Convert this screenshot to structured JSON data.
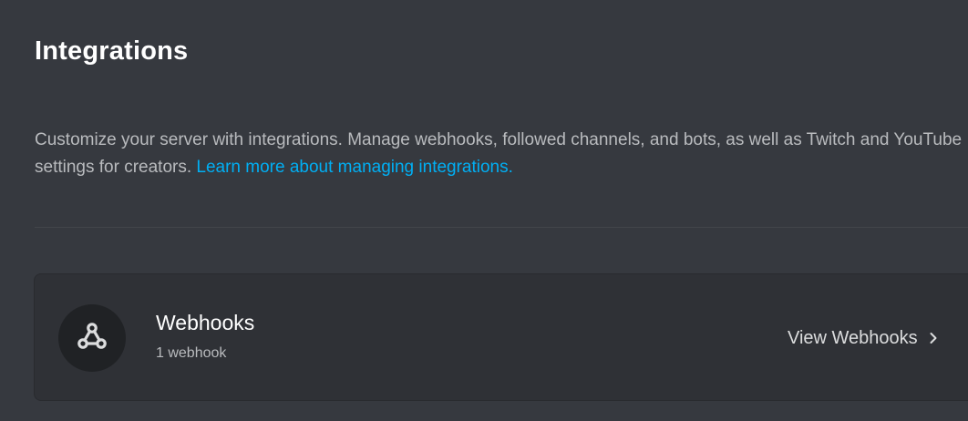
{
  "page": {
    "title": "Integrations",
    "description": "Customize your server with integrations. Manage webhooks, followed channels, and bots, as well as Twitch and YouTube settings for creators.",
    "learn_more_link": "Learn more about managing integrations."
  },
  "webhooks_card": {
    "title": "Webhooks",
    "subtitle": "1 webhook",
    "action_label": "View Webhooks",
    "icon": "webhook-icon"
  },
  "colors": {
    "background": "#36393f",
    "card": "#2f3136",
    "link": "#00aff4",
    "text_primary": "#ffffff",
    "text_muted": "#b9bbbe"
  }
}
